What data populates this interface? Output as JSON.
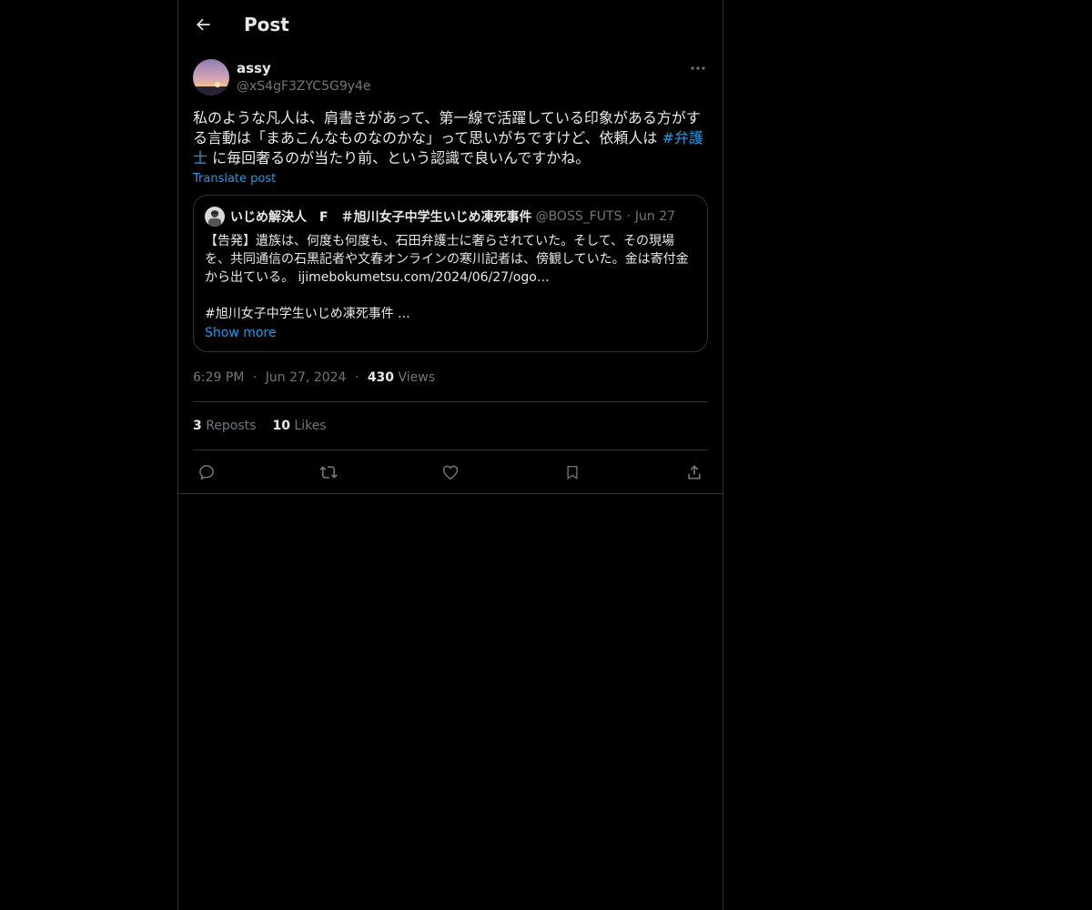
{
  "header": {
    "title": "Post"
  },
  "post": {
    "author_name": "assy",
    "author_handle": "@xS4gF3ZYC5G9y4e",
    "text_before": "私のような凡人は、肩書きがあって、第一線で活躍している印象がある方がする言動は「まあこんなものなのかな」って思いがちですけど、依頼人は ",
    "hashtag": "#弁護士",
    "text_after": " に毎回奢るのが当たり前、という認識で良いんですかね。",
    "translate_label": "Translate post",
    "time": "6:29 PM",
    "date": "Jun 27, 2024",
    "views_count": "430",
    "views_label": "Views",
    "reposts_count": "3",
    "reposts_label": "Reposts",
    "likes_count": "10",
    "likes_label": "Likes"
  },
  "quote": {
    "author_name": "いじめ解決人　F　＃旭川女子中学生いじめ凍死事件",
    "author_handle": "@BOSS_FUTS",
    "date": "Jun 27",
    "line1": "【告発】遺族は、何度も何度も、石田弁護士に奢らされていた。そして、その現場を、共同通信の石黒記者や文春オンラインの寒川記者は、傍観していた。金は寄付金から出ている。 ijimebokumetsu.com/2024/06/27/ogo…",
    "line2": "#旭川女子中学生いじめ凍死事件 ...",
    "show_more": "Show more"
  },
  "icons": {
    "back": "arrow-left-icon",
    "more": "more-dots-icon",
    "reply": "reply-icon",
    "repost": "repost-icon",
    "like": "heart-icon",
    "bookmark": "bookmark-icon",
    "share": "share-icon"
  },
  "colors": {
    "background": "#000000",
    "accent": "#1d9bf0",
    "text": "#e7e9ea",
    "muted": "#71767b",
    "border": "#2f3336"
  }
}
